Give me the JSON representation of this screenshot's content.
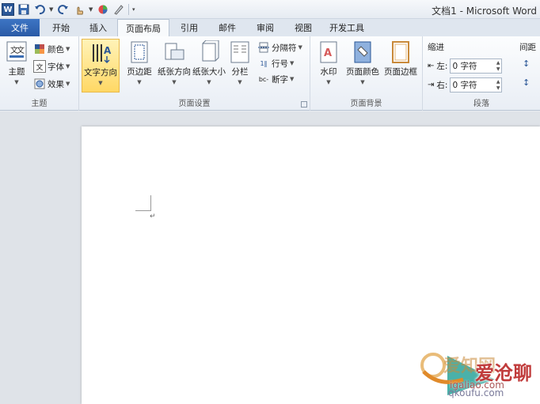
{
  "window": {
    "title": "文档1 - Microsoft Word"
  },
  "quick_access": {
    "word_logo": "W",
    "icons": [
      "save-icon",
      "undo-icon",
      "redo-icon",
      "touch-mode-icon",
      "color-icon",
      "format-painter-icon",
      "customize-icon"
    ]
  },
  "tabs": {
    "file": "文件",
    "items": [
      "开始",
      "插入",
      "页面布局",
      "引用",
      "邮件",
      "审阅",
      "视图",
      "开发工具"
    ],
    "active": "页面布局"
  },
  "ribbon": {
    "theme_group": {
      "label": "主题",
      "themes_button": "主题",
      "colors": "颜色",
      "fonts": "字体",
      "effects": "效果"
    },
    "page_setup_group": {
      "label": "页面设置",
      "text_direction": "文字方向",
      "margins": "页边距",
      "orientation": "纸张方向",
      "size": "纸张大小",
      "columns": "分栏",
      "breaks": "分隔符",
      "line_numbers": "行号",
      "hyphenation": "断字"
    },
    "page_background_group": {
      "label": "页面背景",
      "watermark": "水印",
      "page_color": "页面颜色",
      "page_borders": "页面边框"
    },
    "paragraph_group": {
      "label": "段落",
      "indent_title": "缩进",
      "spacing_title": "间距",
      "left_label": "左:",
      "left_value": "0 字符",
      "right_label": "右:",
      "right_value": "0 字符"
    }
  },
  "document": {
    "paragraph_mark": "↵"
  },
  "watermark": {
    "line1": "爱知网",
    "line2": "爱沧聊",
    "line3": "igaliao.com",
    "line4": "qkoufu.com"
  },
  "colors": {
    "accent": "#2b5797",
    "file_tab": "#2a5aa6",
    "highlight": "#ffd865"
  }
}
